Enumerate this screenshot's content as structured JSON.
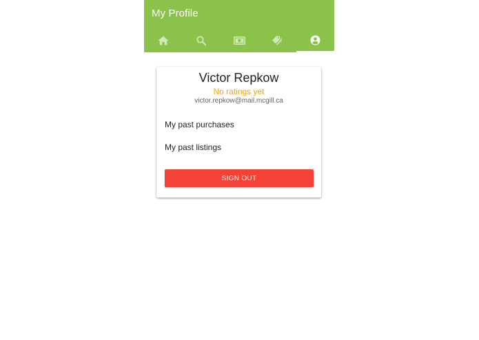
{
  "app_bar": {
    "title": "My Profile",
    "background_color": "#8bc34a"
  },
  "tabs": [
    {
      "icon": "home-icon",
      "active": false
    },
    {
      "icon": "search-icon",
      "active": false
    },
    {
      "icon": "money-icon",
      "active": false
    },
    {
      "icon": "tags-icon",
      "active": false
    },
    {
      "icon": "account-circle-icon",
      "active": true
    }
  ],
  "profile": {
    "name": "Victor Repkow",
    "rating_text": "No ratings yet",
    "rating_color": "#f2a20c",
    "email": "victor.repkow@mail.mcgill.ca"
  },
  "menu": {
    "past_purchases_label": "My past purchases",
    "past_listings_label": "My past listings"
  },
  "sign_out": {
    "label": "SIGN OUT",
    "color": "#f44336"
  }
}
